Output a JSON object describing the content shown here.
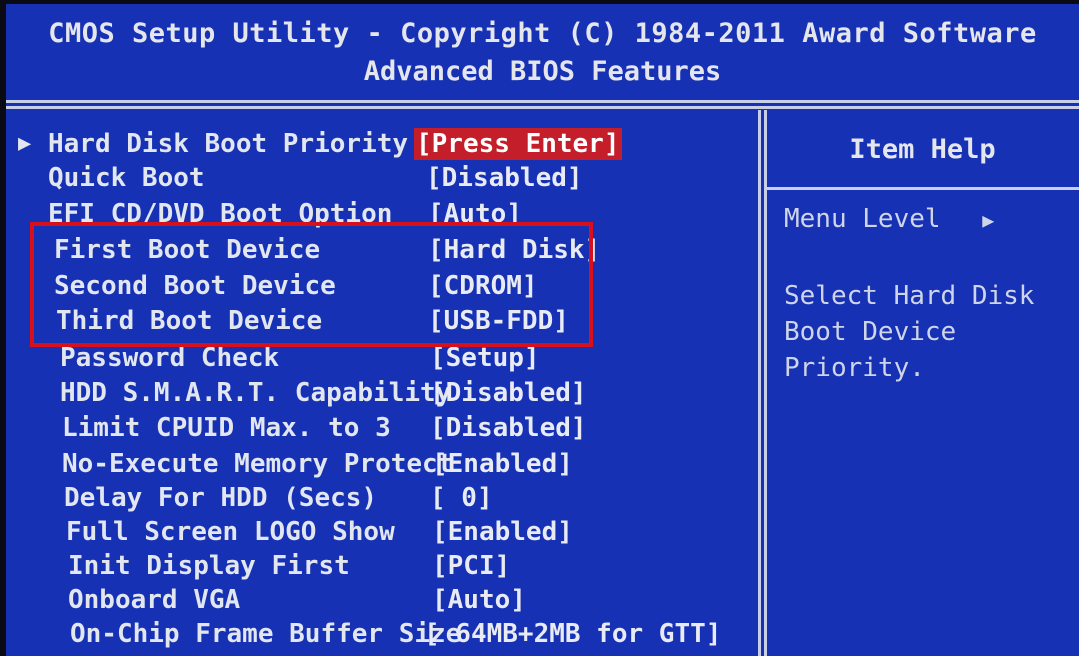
{
  "header": {
    "title_line1": "CMOS Setup Utility - Copyright (C) 1984-2011 Award Software",
    "title_line2": "Advanced BIOS Features"
  },
  "settings": [
    {
      "label": "Hard Disk Boot Priority",
      "value": "[Press Enter]",
      "selected": true,
      "submenu": true
    },
    {
      "label": "Quick Boot",
      "value": "[Disabled]"
    },
    {
      "label": "EFI CD/DVD Boot Option",
      "value": "[Auto]"
    },
    {
      "label": "First Boot Device",
      "value": "[Hard Disk]"
    },
    {
      "label": "Second Boot Device",
      "value": "[CDROM]"
    },
    {
      "label": "Third Boot Device",
      "value": "[USB-FDD]"
    },
    {
      "label": "Password Check",
      "value": "[Setup]"
    },
    {
      "label": "HDD S.M.A.R.T. Capability",
      "value": "[Disabled]"
    },
    {
      "label": "Limit CPUID Max. to 3",
      "value": "[Disabled]"
    },
    {
      "label": "No-Execute Memory Protect",
      "value": "[Enabled]"
    },
    {
      "label": "Delay For HDD (Secs)",
      "value": "[ 0]"
    },
    {
      "label": "Full Screen LOGO Show",
      "value": "[Enabled]"
    },
    {
      "label": "Init Display First",
      "value": "[PCI]"
    },
    {
      "label": "Onboard VGA",
      "value": "[Auto]"
    },
    {
      "label": "On-Chip Frame Buffer Size",
      "value": "[ 64MB+2MB for GTT]"
    }
  ],
  "help": {
    "title": "Item Help",
    "menu_level_label": "Menu Level",
    "menu_level_icon": "triangle-right-icon",
    "text": "Select Hard Disk Boot Device Priority."
  },
  "annotation": {
    "highlight_color": "#d8101c"
  },
  "colors": {
    "background": "#1631b4",
    "text": "#e2e6ef",
    "selected_bg": "#c41e2b",
    "lines": "#c9cfe6"
  }
}
